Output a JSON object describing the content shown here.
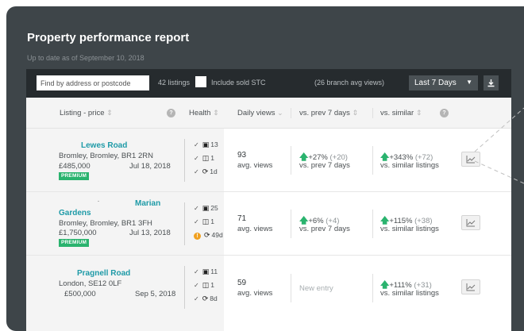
{
  "report": {
    "title": "Property performance report",
    "subtitle": "Up to date as of September 10, 2018"
  },
  "toolbar": {
    "search_placeholder": "Find by address or postcode",
    "listings_count": "42 listings",
    "include_sold_label": "Include sold STC",
    "branch_avg": "(26 branch avg views)",
    "range_selected": "Last 7 Days",
    "caret": "▼",
    "download_icon": "download-icon"
  },
  "columns": {
    "listing": "Listing - price",
    "health": "Health",
    "daily_views": "Daily views",
    "vs_prev": "vs. prev 7 days",
    "vs_similar": "vs. similar",
    "sort_glyph": "⇕",
    "sort_down_glyph": "⌄",
    "help_glyph": "?"
  },
  "rows": [
    {
      "name": "Lewes Road",
      "address": "Bromley, Bromley, BR1 2RN",
      "price": "£485,000",
      "date": "Jul 18, 2018",
      "badge": "PREMIUM",
      "health": {
        "photos": "13",
        "floorplans": "1",
        "age": "1d",
        "age_warning": false
      },
      "views": "93",
      "views_label": "avg. views",
      "prev_change": "+27%",
      "prev_abs": "(+20)",
      "prev_label": "vs. prev 7 days",
      "sim_change": "+343%",
      "sim_abs": "(+72)",
      "sim_label": "vs. similar listings"
    },
    {
      "name": "Marian Gardens",
      "name_line1": "Marian",
      "name_line2": "Gardens",
      "address": "Bromley, Bromley, BR1 3FH",
      "price": "£1,750,000",
      "date": "Jul 13, 2018",
      "badge": "PREMIUM",
      "health": {
        "photos": "25",
        "floorplans": "1",
        "age": "49d",
        "age_warning": true
      },
      "views": "71",
      "views_label": "avg. views",
      "prev_change": "+6%",
      "prev_abs": "(+4)",
      "prev_label": "vs. prev 7 days",
      "sim_change": "+115%",
      "sim_abs": "(+38)",
      "sim_label": "vs. similar listings"
    },
    {
      "name": "Pragnell Road",
      "address": "London, SE12 0LF",
      "price": "£500,000",
      "date": "Sep 5, 2018",
      "health": {
        "photos": "11",
        "floorplans": "1",
        "age": "8d",
        "age_warning": false
      },
      "views": "59",
      "views_label": "avg. views",
      "prev_new": "New entry",
      "sim_change": "+111%",
      "sim_abs": "(+31)",
      "sim_label": "vs. similar listings"
    }
  ],
  "glyphs": {
    "check": "✓",
    "warning": "!",
    "up_arrow": "🡅"
  },
  "colors": {
    "panel_bg": "#3e4549",
    "toolbar_bg": "#262b2e",
    "link": "#1e9aa7",
    "positive": "#2ab36e",
    "warning": "#f0a020"
  }
}
